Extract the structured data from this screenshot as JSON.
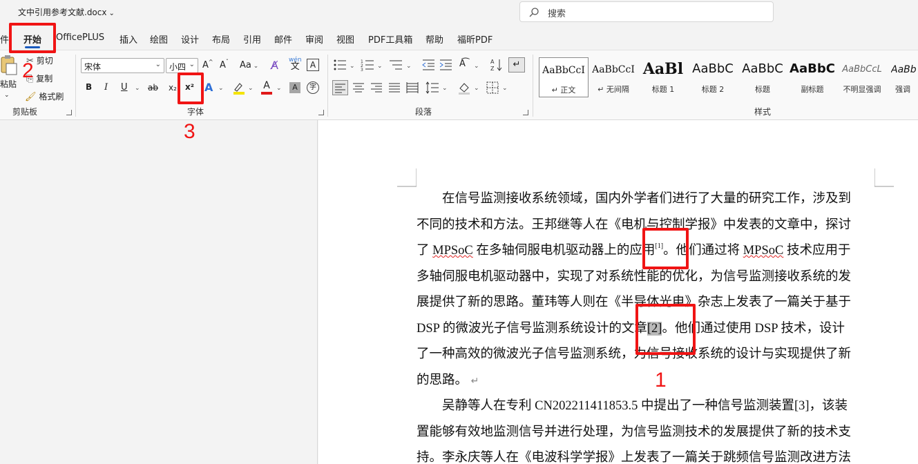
{
  "title_bar": {
    "document_name": "文中引用参考文献.docx",
    "search_placeholder": "搜索"
  },
  "tabs": [
    "件",
    "开始",
    "OfficePLUS",
    "插入",
    "绘图",
    "设计",
    "布局",
    "引用",
    "邮件",
    "审阅",
    "视图",
    "PDF工具箱",
    "帮助",
    "福昕PDF"
  ],
  "active_tab": "开始",
  "ribbon": {
    "clipboard": {
      "label": "剪贴板",
      "paste": "粘贴",
      "cut": "剪切",
      "copy": "复制",
      "format_painter": "格式刷"
    },
    "font": {
      "label": "字体",
      "font_name": "宋体",
      "font_size": "小四",
      "bold": "B",
      "italic": "I",
      "underline": "U",
      "strike": "ab",
      "subscript": "x₂",
      "superscript": "x²",
      "change_case": "Aa",
      "phonetic": "wén",
      "grow": "A",
      "shrink": "A"
    },
    "paragraph": {
      "label": "段落"
    },
    "styles": {
      "label": "样式",
      "items": [
        {
          "sample": "AaBbCcI",
          "name": "↵ 正文"
        },
        {
          "sample": "AaBbCcI",
          "name": "↵ 无间隔"
        },
        {
          "sample": "AaBl",
          "name": "标题 1"
        },
        {
          "sample": "AaBbC",
          "name": "标题 2"
        },
        {
          "sample": "AaBbC",
          "name": "标题"
        },
        {
          "sample": "AaBbC",
          "name": "副标题"
        },
        {
          "sample": "AaBbCcL",
          "name": "不明显强调"
        },
        {
          "sample": "AaBb",
          "name": "强调"
        }
      ]
    }
  },
  "document": {
    "lines": [
      {
        "pre": "　　在信号监测接收系统领域，国内外学者们进行了大量的研究工作，涉及到"
      },
      {
        "pre": "不同的技术和方法。王邦继等人在《电机与控制学报》中发表的文章中，探讨"
      },
      {
        "pre": "了 ",
        "sq": "MPSoC",
        "mid": " 在多轴伺服电机驱动器上的应用",
        "sup": "[1]",
        "mid2": "。他们通过将 ",
        "sq2": "MPSoC",
        "post": " 技术应用于"
      },
      {
        "pre": "多轴伺服电机驱动器中，实现了对系统性能的优化，为信号监测接收系统的发"
      },
      {
        "pre": "展提供了新的思路。董玮等人则在《半导体光电》杂志上发表了一篇关于基于"
      },
      {
        "pre": "DSP 的微波光子信号监测系统设计的文章",
        "hl": "[2]",
        "post": "。他们通过使用 DSP 技术，设计"
      },
      {
        "pre": "了一种高效的微波光子信号监测系统，为信号接收系统的设计与实现提供了新"
      },
      {
        "pre": "的思路。",
        "pilcrow": "↵"
      },
      {
        "pre": "　　吴静等人在专利 CN202211411853.5 中提出了一种信号监测装置[3]，该装"
      },
      {
        "pre": "置能够有效地监测信号并进行处理，为信号监测技术的发展提供了新的技术支"
      },
      {
        "pre": "持。李永庆等人在《电波科学学报》上发表了一篇关于跳频信号监测改进方法"
      }
    ]
  },
  "annotations": [
    "1",
    "2",
    "3"
  ],
  "colors": {
    "annotation_red": "#f01414",
    "accent_blue": "#185abd"
  }
}
